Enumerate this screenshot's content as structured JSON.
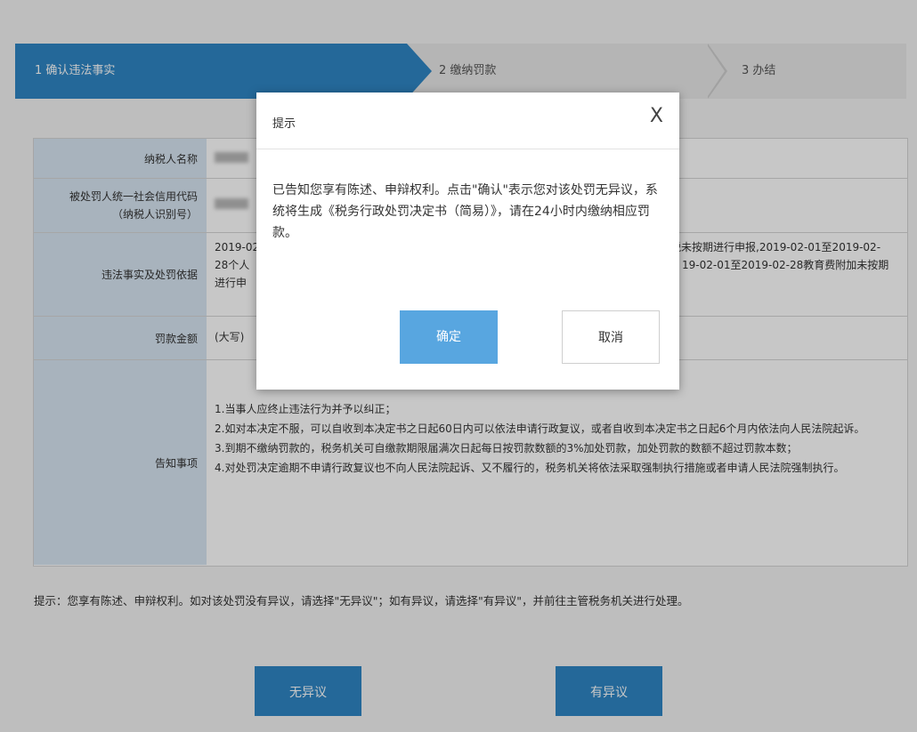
{
  "steps": {
    "step1": "1 确认违法事实",
    "step2": "2 缴纳罚款",
    "step3": "3 办结"
  },
  "table": {
    "taxpayer_name_label": "纳税人名称",
    "credit_code_label_line1": "被处罚人统一社会信用代码",
    "credit_code_label_line2": "（纳税人识别号）",
    "violation_label": "违法事实及处罚依据",
    "violation_text_prefix": "2019-02",
    "violation_text_line2_prefix": "28个人",
    "violation_text_line3_prefix": "进行申",
    "violation_text_line1_suffix": "税未按期进行申报,2019-02-01至2019-02-",
    "violation_text_line2_suffix": "19-02-01至2019-02-28教育费附加未按期",
    "amount_label": "罚款金额",
    "amount_value_prefix": "(大写)",
    "notice_label": "告知事项",
    "notice_1": "1.当事人应终止违法行为并予以纠正；",
    "notice_2": "2.如对本决定不服，可以自收到本决定书之日起60日内可以依法申请行政复议，或者自收到本决定书之日起6个月内依法向人民法院起诉。",
    "notice_3": "3.到期不缴纳罚款的，税务机关可自缴款期限届满次日起每日按罚款数额的3%加处罚款，加处罚款的数额不超过罚款本数；",
    "notice_4": "4.对处罚决定逾期不申请行政复议也不向人民法院起诉、又不履行的，税务机关将依法采取强制执行措施或者申请人民法院强制执行。"
  },
  "hint": "提示：您享有陈述、申辩权利。如对该处罚没有异议，请选择\"无异议\"；如有异议，请选择\"有异议\"，并前往主管税务机关进行处理。",
  "buttons": {
    "no_objection": "无异议",
    "objection": "有异议"
  },
  "modal": {
    "title": "提示",
    "close": "X",
    "body": "已告知您享有陈述、申辩权利。点击\"确认\"表示您对该处罚无异议，系统将生成《税务行政处罚决定书（简易）》，请在24小时内缴纳相应罚款。",
    "ok": "确定",
    "cancel": "取消"
  }
}
